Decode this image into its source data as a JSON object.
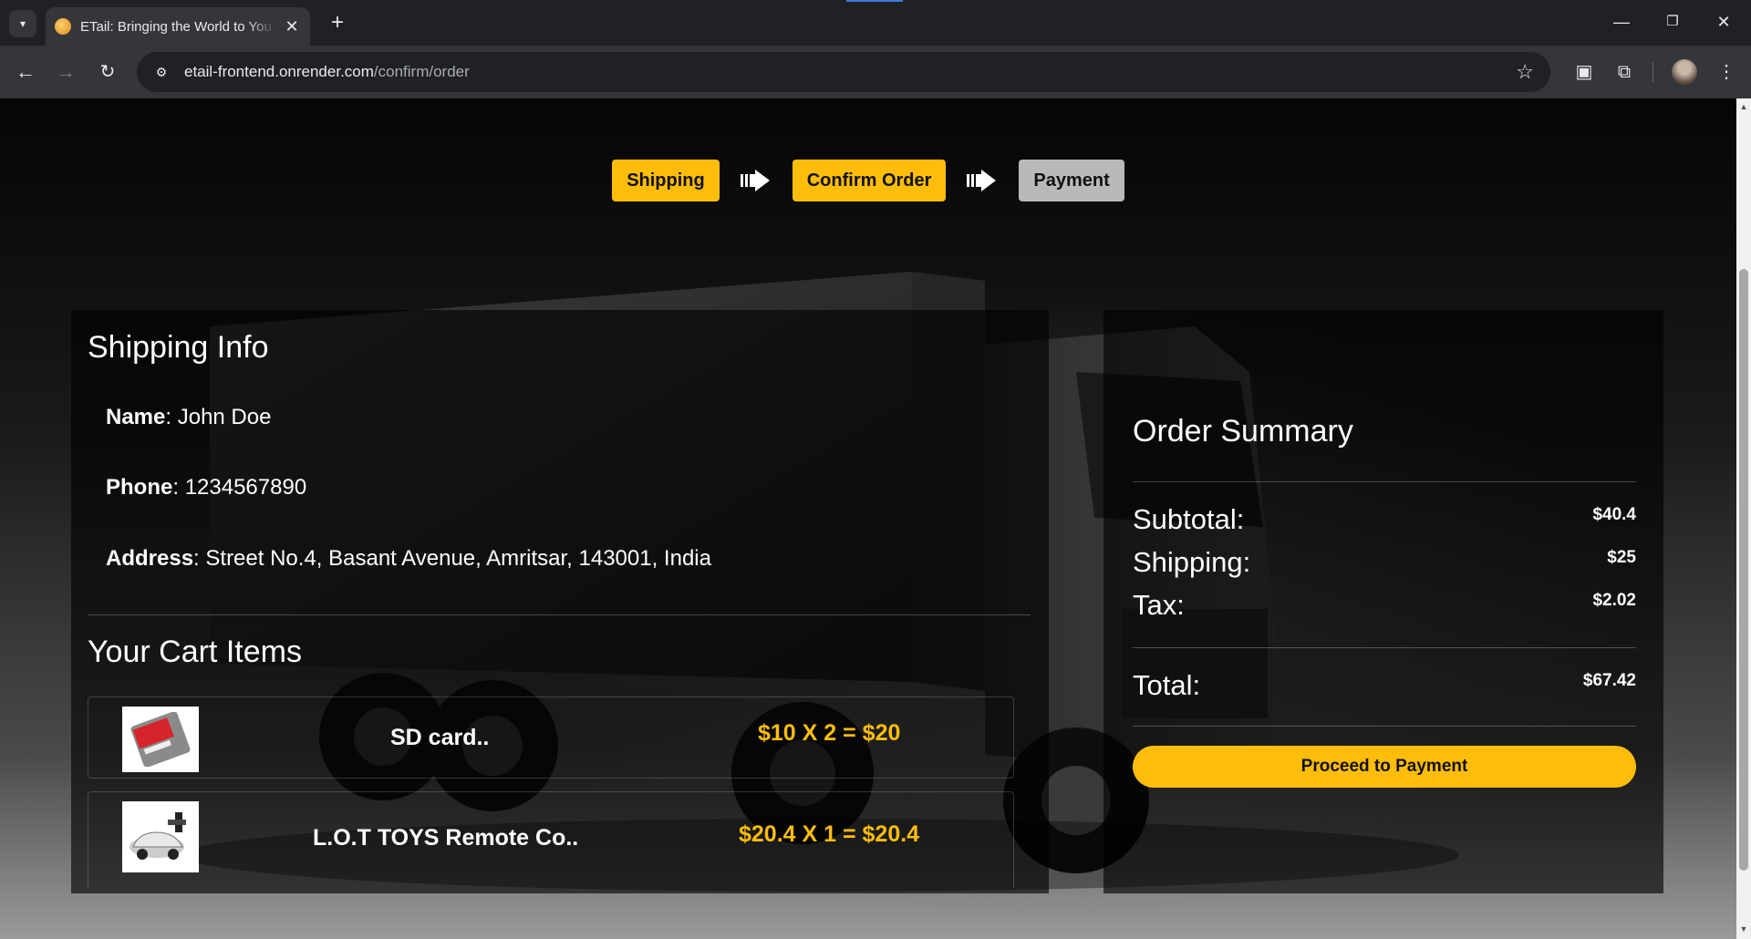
{
  "browser": {
    "tab_title": "ETail: Bringing the World to You",
    "url_host": "etail-frontend.onrender.com",
    "url_path": "/confirm/order"
  },
  "steps": [
    {
      "label": "Shipping",
      "state": "active"
    },
    {
      "label": "Confirm Order",
      "state": "active"
    },
    {
      "label": "Payment",
      "state": "inactive"
    }
  ],
  "shipping_info": {
    "title": "Shipping Info",
    "name_label": "Name",
    "name": "John Doe",
    "phone_label": "Phone",
    "phone": "1234567890",
    "address_label": "Address",
    "address": "Street No.4, Basant Avenue, Amritsar, 143001, India"
  },
  "cart": {
    "title": "Your Cart Items",
    "items": [
      {
        "name": "SD card..",
        "price": "$10 X 2 = $20",
        "icon": "sd-card-image"
      },
      {
        "name": "L.O.T TOYS Remote Co..",
        "price": "$20.4 X 1 = $20.4",
        "icon": "rc-car-image"
      }
    ]
  },
  "summary": {
    "title": "Order Summary",
    "subtotal_label": "Subtotal:",
    "subtotal": "$40.4",
    "shipping_label": "Shipping:",
    "shipping": "$25",
    "tax_label": "Tax:",
    "tax": "$2.02",
    "total_label": "Total:",
    "total": "$67.42",
    "proceed_label": "Proceed to Payment"
  },
  "colors": {
    "accent": "#fdbd0a",
    "inactive_step": "#b9b9b9"
  }
}
